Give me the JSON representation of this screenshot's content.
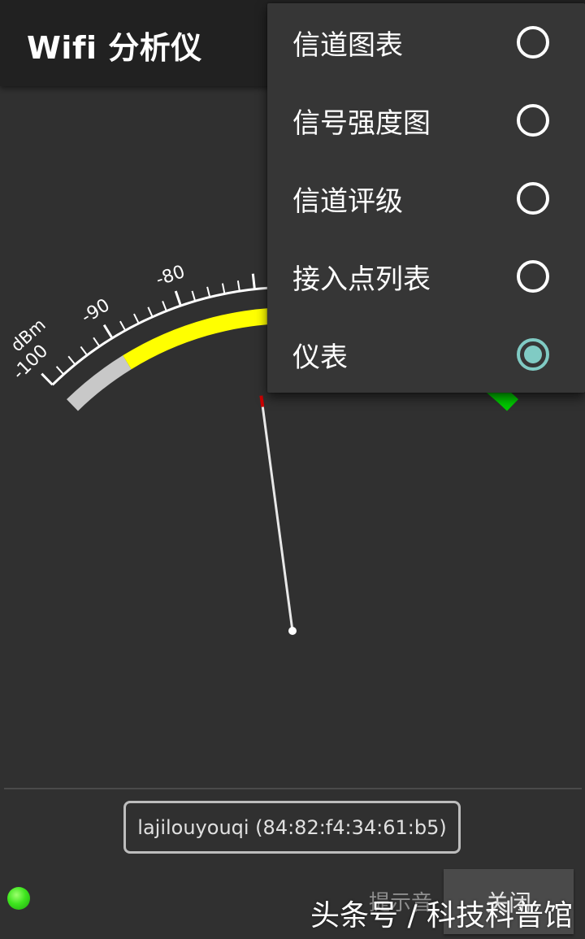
{
  "app": {
    "title": "Wifi 分析仪"
  },
  "gauge": {
    "unit": "dBm",
    "tick_labels": [
      "-100",
      "-90",
      "-80"
    ],
    "needle_value": -71
  },
  "menu": {
    "items": [
      {
        "label": "信道图表",
        "checked": false
      },
      {
        "label": "信号强度图",
        "checked": false
      },
      {
        "label": "信道评级",
        "checked": false
      },
      {
        "label": "接入点列表",
        "checked": false
      },
      {
        "label": "仪表",
        "checked": true
      }
    ]
  },
  "footer": {
    "access_point": "lajilouyouqi (84:82:f4:34:61:b5)",
    "sound_label": "提示音",
    "close_button": "关闭"
  },
  "watermark": "头条号 / 科技科普馆",
  "colors": {
    "background": "#303030",
    "appbar": "#212121",
    "menu": "#363636",
    "accent": "#80cbc4",
    "gauge_weak": "#c8c8c8",
    "gauge_medium": "#ffff00",
    "gauge_strong": "#00c800",
    "needle_marker": "#cc0000",
    "status_led": "#3ee51e"
  }
}
